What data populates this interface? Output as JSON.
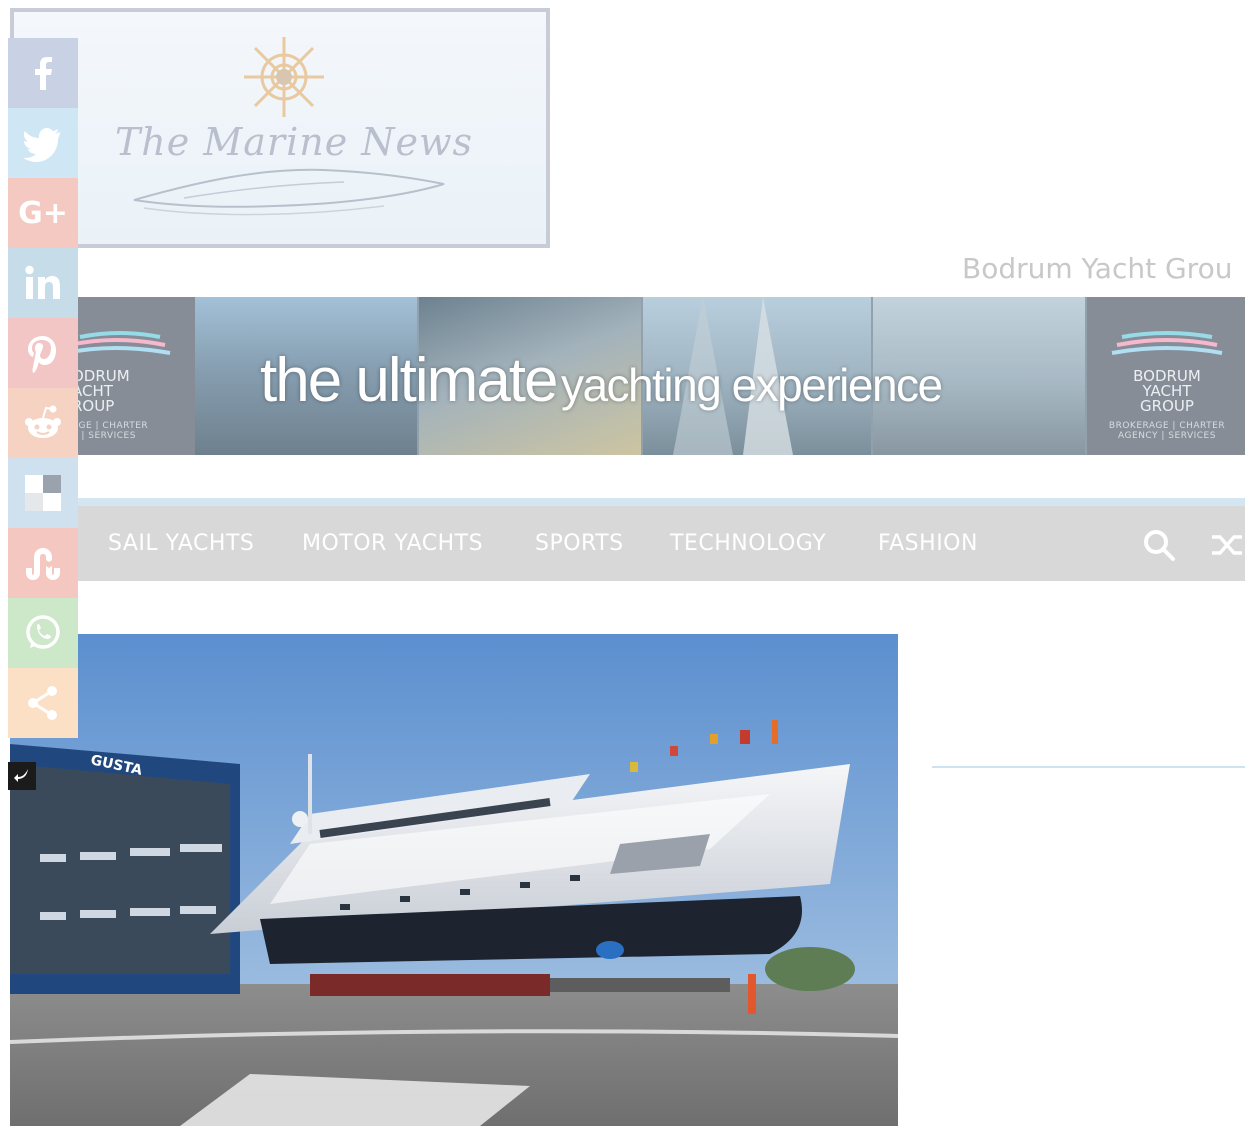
{
  "logo": {
    "title": "The Marine News"
  },
  "tagline": "Bodrum Yacht Grou",
  "banner": {
    "slogan_big": "the ultimate",
    "slogan_small": "yachting experience",
    "brand_left": {
      "line1": "ODRUM",
      "line2": "ACHT",
      "line3": "ROUP",
      "sub1": "AGE | CHARTER",
      "sub2": "Y | SERVICES"
    },
    "brand_right": {
      "line1": "BODRUM",
      "line2": "YACHT",
      "line3": "GROUP",
      "sub1": "BROKERAGE | CHARTER",
      "sub2": "AGENCY | SERVICES"
    }
  },
  "nav": {
    "items": [
      {
        "label": "SAIL YACHTS"
      },
      {
        "label": "MOTOR YACHTS"
      },
      {
        "label": "SPORTS"
      },
      {
        "label": "TECHNOLOGY"
      },
      {
        "label": "FASHION"
      }
    ],
    "icons": [
      "search-icon",
      "shuffle-icon"
    ]
  },
  "featured": {
    "shipyard_sign": "GUSTA"
  },
  "share": {
    "buttons": [
      {
        "icon": "facebook-icon",
        "color": "#c9d1e4"
      },
      {
        "icon": "twitter-icon",
        "color": "#cfe6f5"
      },
      {
        "icon": "google-plus-icon",
        "label": "G+",
        "color": "#f3c9c1"
      },
      {
        "icon": "linkedin-icon",
        "color": "#c7dce9"
      },
      {
        "icon": "pinterest-icon",
        "color": "#f3c6c6"
      },
      {
        "icon": "reddit-icon",
        "color": "#f6d2c3"
      },
      {
        "icon": "delicious-icon",
        "color": "#cfe0ef"
      },
      {
        "icon": "stumbleupon-icon",
        "color": "#f4c8c0"
      },
      {
        "icon": "whatsapp-icon",
        "color": "#cde7c9"
      },
      {
        "icon": "share-icon",
        "color": "#fbe0c6"
      }
    ]
  },
  "colors": {
    "nav_bg": "#d8d8d8",
    "nav_text": "#ffffff",
    "accent_line": "#d3e6f2",
    "tagline": "#c8c8c8"
  }
}
